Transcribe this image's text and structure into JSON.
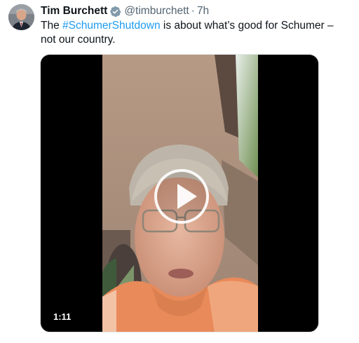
{
  "author": {
    "display_name": "Tim Burchett",
    "handle": "@timburchett",
    "separator": "·",
    "timestamp": "7h",
    "verified_icon": "verified-badge-icon"
  },
  "tweet": {
    "text_before": "The ",
    "hashtag": "#SchumerShutdown",
    "text_after": " is about what’s good for Schumer – not our country."
  },
  "video": {
    "duration": "1:11",
    "play_icon": "play-icon"
  },
  "colors": {
    "hashtag": "#1d9bf0",
    "verified_badge": "#829aab",
    "secondary_text": "#536471",
    "primary_text": "#0f1419"
  }
}
